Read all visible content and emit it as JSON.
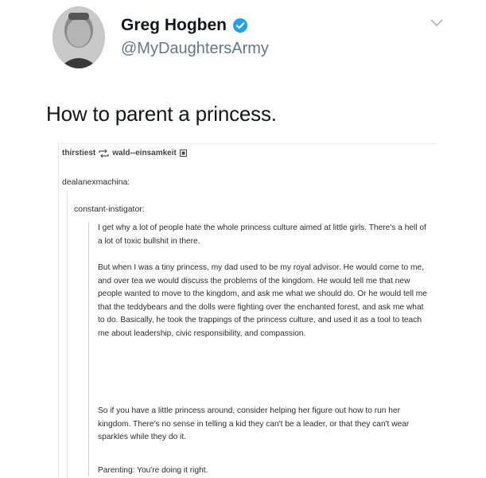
{
  "tweet": {
    "display_name": "Greg Hogben",
    "handle": "@MyDaughtersArmy",
    "verified_icon": "verified-badge-icon",
    "text": "How to parent a princess."
  },
  "screenshot": {
    "reblog": {
      "user1": "thirstiest",
      "user2": "wald--einsamkeit"
    },
    "op": "dealanexmachina:",
    "poster": "constant-instigator:",
    "paragraphs": [
      "I get why a lot of people hate the whole princess culture aimed at little girls. There's a hell of a lot of toxic bullshit in there.",
      "But when I was a tiny princess, my dad used to be my royal advisor. He would come to me, and over tea we would discuss the problems of the kingdom. He would tell me that new people wanted to move to the kingdom, and ask me what we should do. Or he would tell me that the teddybears and the dolls were fighting over the enchanted forest, and ask me what to do. Basically, he took the trappings of the princess culture, and used it as a tool to teach me about leadership, civic responsibility, and compassion.",
      "So if you have a little princess around, consider helping her figure out how to run her kingdom. There's no sense in telling a kid they can't be a leader, or that they can't wear sparkles while they do it.",
      "Parenting: You're doing it right."
    ]
  },
  "colors": {
    "verified": "#1da1f2",
    "handle": "#657786"
  }
}
